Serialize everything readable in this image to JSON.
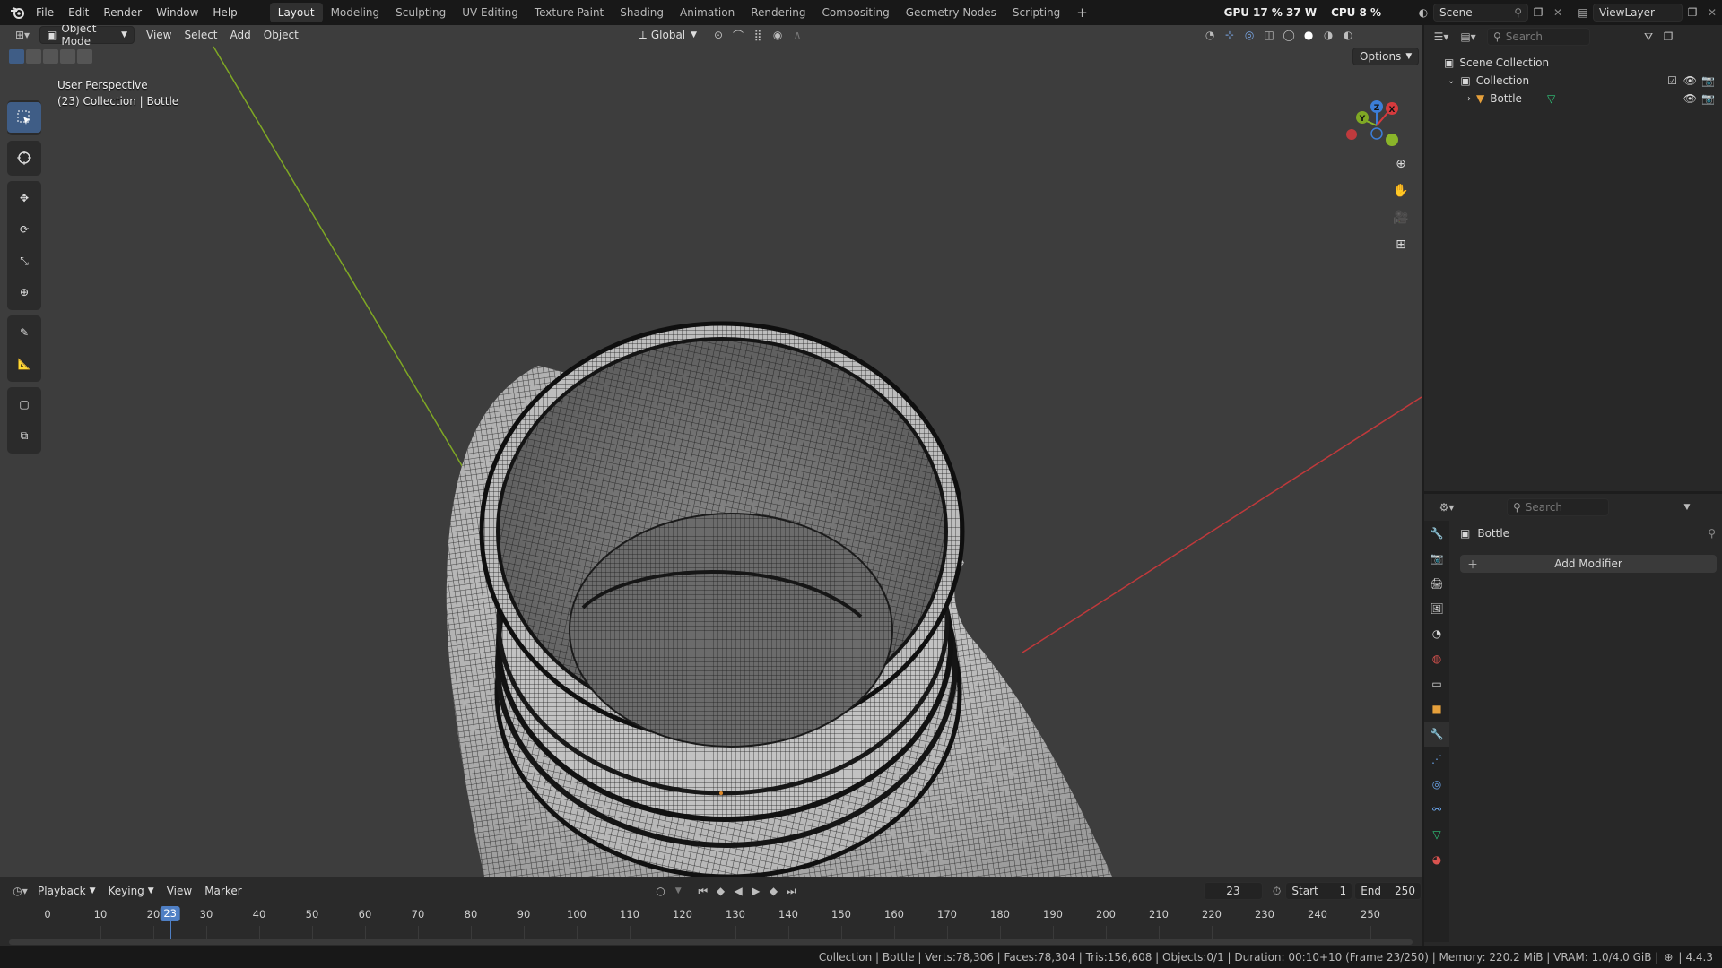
{
  "topbar": {
    "menus": [
      "File",
      "Edit",
      "Render",
      "Window",
      "Help"
    ],
    "workspaces": [
      "Layout",
      "Modeling",
      "Sculpting",
      "UV Editing",
      "Texture Paint",
      "Shading",
      "Animation",
      "Rendering",
      "Compositing",
      "Geometry Nodes",
      "Scripting"
    ],
    "active_workspace": "Layout",
    "add_workspace": "+",
    "gpu_label": "GPU",
    "gpu_value": "17 %",
    "gpu_power": "37 W",
    "cpu_label": "CPU",
    "cpu_value": "8 %",
    "scene": "Scene",
    "view_layer": "ViewLayer"
  },
  "viewport": {
    "mode": "Object Mode",
    "menus": [
      "View",
      "Select",
      "Add",
      "Object"
    ],
    "orientation": "Global",
    "options_label": "Options",
    "overlay_line1": "User Perspective",
    "overlay_line2": "(23) Collection | Bottle",
    "gizmo_axes": {
      "x": "X",
      "y": "Y",
      "z": "Z"
    },
    "colors": {
      "background": "#3d3d3d",
      "x_axis": "#c0393b",
      "y_axis": "#7fa824",
      "active_tool": "#3f5d86"
    }
  },
  "timeline": {
    "menus": [
      "Playback",
      "Keying",
      "View",
      "Marker"
    ],
    "current_frame": "23",
    "start_label": "Start",
    "start": "1",
    "end_label": "End",
    "end": "250",
    "ticks": [
      "0",
      "10",
      "20",
      "30",
      "40",
      "50",
      "60",
      "70",
      "80",
      "90",
      "100",
      "110",
      "120",
      "130",
      "140",
      "150",
      "160",
      "170",
      "180",
      "190",
      "200",
      "210",
      "220",
      "230",
      "240",
      "250"
    ],
    "playhead_label": "23"
  },
  "outliner": {
    "search_placeholder": "Search",
    "scene_collection": "Scene Collection",
    "collection": "Collection",
    "object": "Bottle"
  },
  "properties": {
    "search_placeholder": "Search",
    "object_name": "Bottle",
    "add_modifier": "Add Modifier"
  },
  "statusbar": {
    "text": "Collection | Bottle | Verts:78,306 | Faces:78,304 | Tris:156,608 | Objects:0/1 | Duration: 00:10+10 (Frame 23/250) | Memory: 220.2 MiB | VRAM: 1.0/4.0 GiB |",
    "version": "4.4.3"
  }
}
